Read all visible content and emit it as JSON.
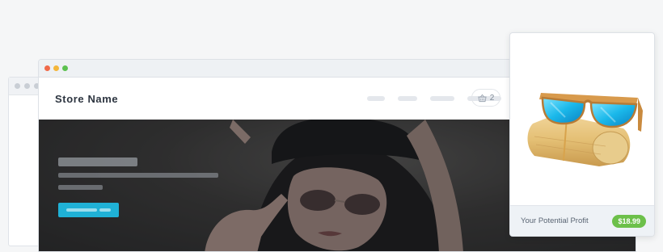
{
  "store": {
    "name": "Store Name",
    "cart_count": "2"
  },
  "card": {
    "profit_label": "Your Potential Profit",
    "price": "$18.99"
  },
  "colors": {
    "accent": "#1fb1d6",
    "price_badge": "#6cc04a",
    "lens": "#2fc6ee",
    "wood": "#d9a15a"
  }
}
